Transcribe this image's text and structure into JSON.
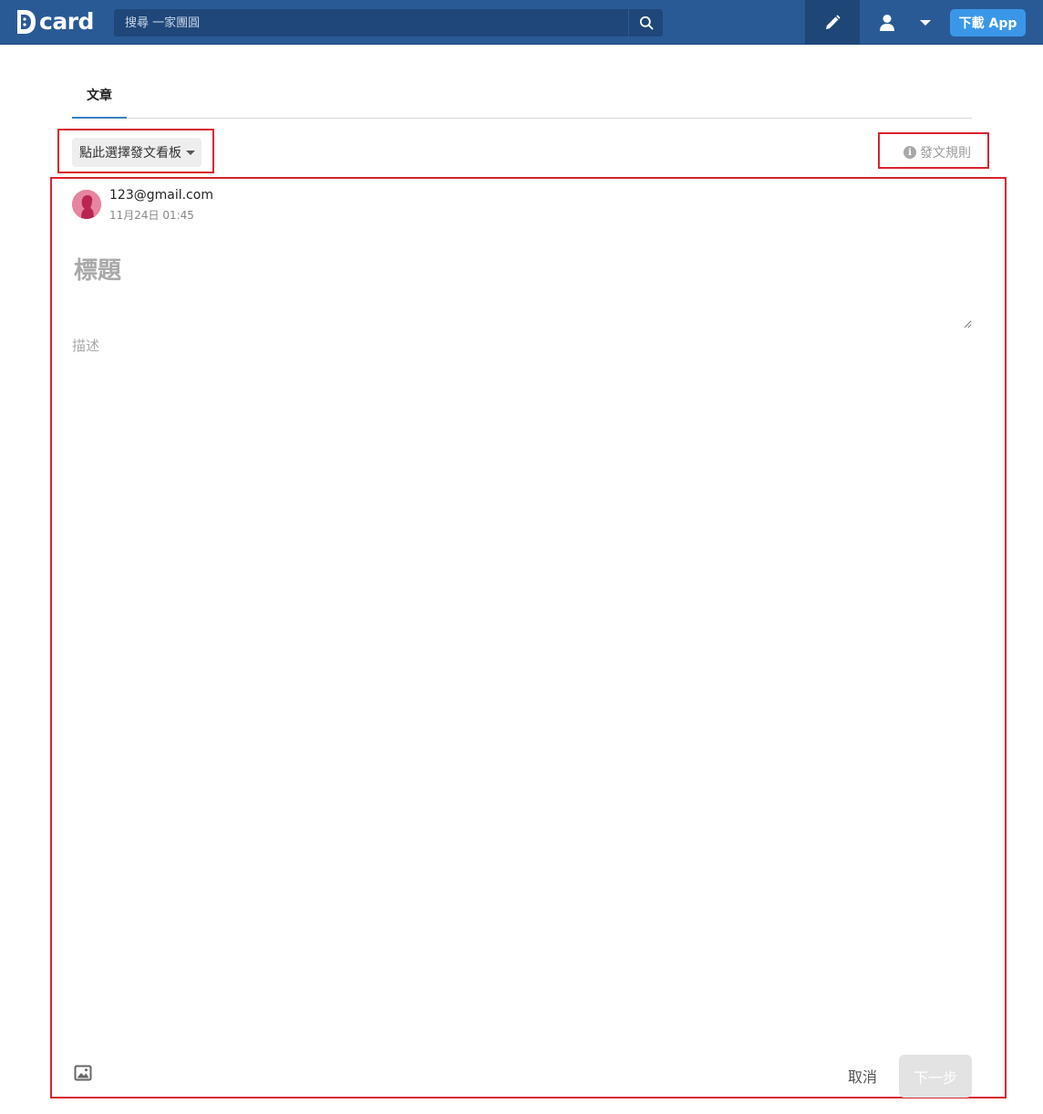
{
  "header": {
    "logo_text": "card",
    "search_placeholder": "搜尋 一家團圓",
    "download_label": "下載 App",
    "brand_color": "#2a5a96",
    "accent_color": "#3a97e8",
    "icons": [
      "search-icon",
      "pencil-icon",
      "user-icon",
      "caret-down-icon"
    ]
  },
  "tabs": [
    {
      "label": "文章",
      "active": true
    }
  ],
  "board_picker": {
    "label": "點此選擇發文看板"
  },
  "rules_link": {
    "label": "發文規則"
  },
  "post": {
    "author": "123@gmail.com",
    "time": "11月24日 01:45",
    "title_placeholder": "標題",
    "desc_placeholder": "描述"
  },
  "footer": {
    "cancel_label": "取消",
    "next_label": "下一步"
  },
  "highlight_color": "#d9232e"
}
